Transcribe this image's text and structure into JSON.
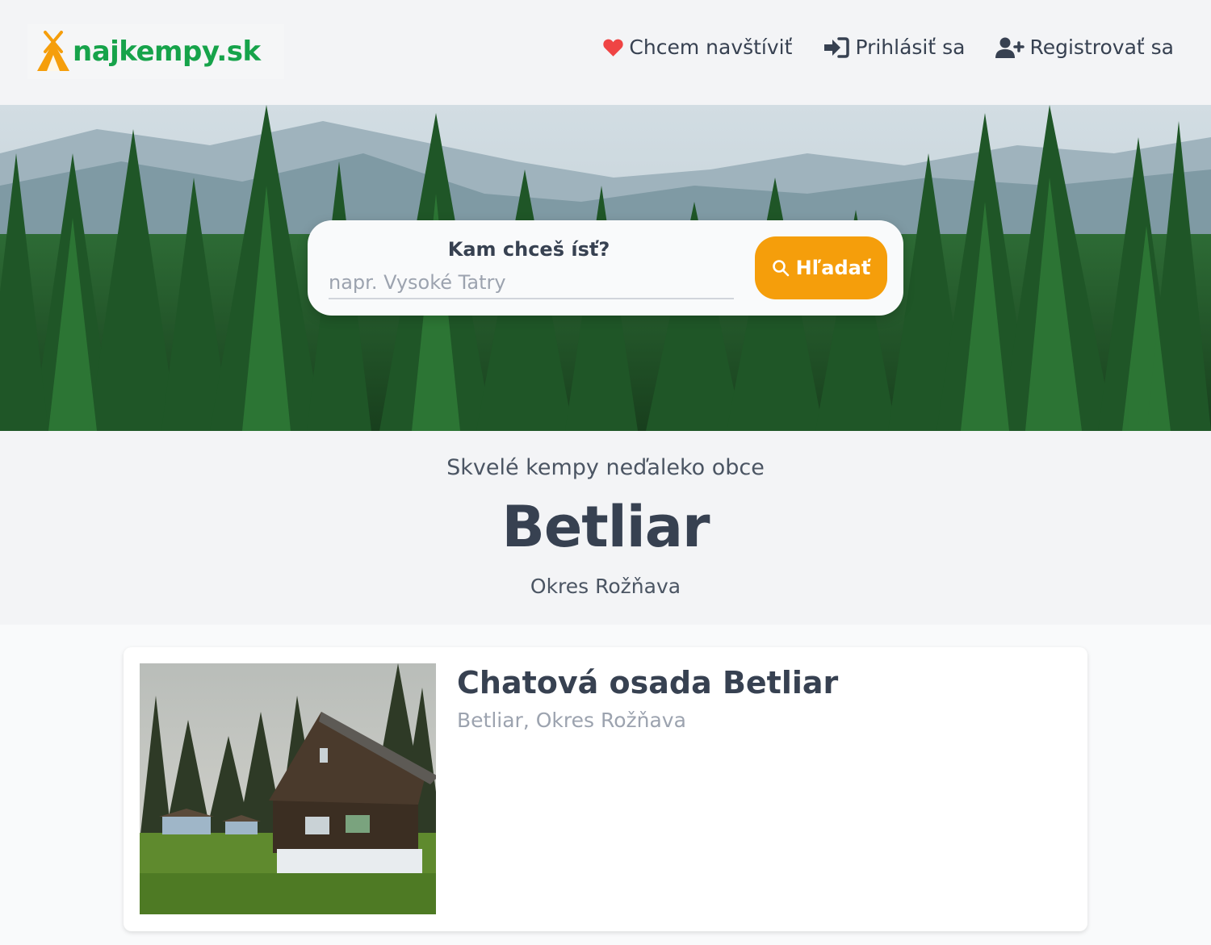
{
  "header": {
    "logo_text": "najkempy.sk",
    "nav": {
      "wishlist_label": "Chcem navštíviť",
      "login_label": "Prihlásiť sa",
      "register_label": "Registrovať sa"
    }
  },
  "search": {
    "label": "Kam chceš ísť?",
    "placeholder": "napr. Vysoké Tatry",
    "value": "",
    "button_label": "Hľadať"
  },
  "intro": {
    "subtitle": "Skvelé kempy neďaleko obce",
    "title": "Betliar",
    "district": "Okres Rožňava"
  },
  "results": [
    {
      "title": "Chatová osada Betliar",
      "location": "Betliar, Okres Rožňava"
    }
  ],
  "colors": {
    "brand_green": "#16a34a",
    "accent_orange": "#f59e0b",
    "heart_red": "#ef4444",
    "text_dark": "#374151"
  },
  "icons": {
    "wishlist": "heart-icon",
    "login": "sign-in-icon",
    "register": "user-plus-icon",
    "search": "search-icon"
  }
}
